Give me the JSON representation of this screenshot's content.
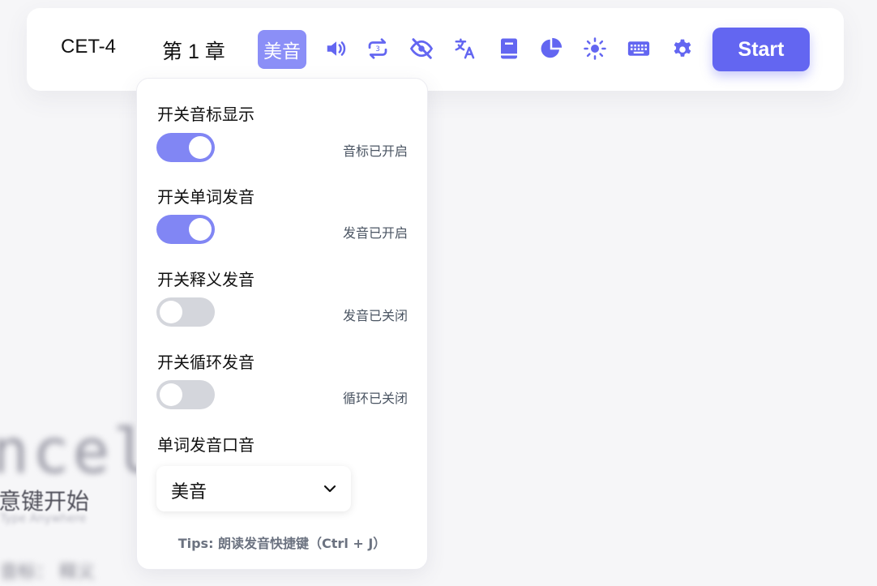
{
  "background": {
    "word_fragment": "ncel",
    "hint": "意键开始",
    "sub": "Type Anywhere",
    "bottom": "音标：  释义"
  },
  "toolbar": {
    "dictionary": "CET-4",
    "chapter": "第 1 章",
    "accent_label": "美音",
    "start_label": "Start",
    "icons": [
      "speaker-icon",
      "repeat-icon",
      "eye-off-icon",
      "translate-icon",
      "book-icon",
      "pie-chart-icon",
      "sun-icon",
      "keyboard-icon",
      "gear-icon"
    ],
    "accent_color": "#6366f1"
  },
  "panel": {
    "phonetic": {
      "title": "开关音标显示",
      "state": true,
      "status": "音标已开启"
    },
    "word_sound": {
      "title": "开关单词发音",
      "state": true,
      "status": "发音已开启"
    },
    "definition_sound": {
      "title": "开关释义发音",
      "state": false,
      "status": "发音已关闭"
    },
    "loop_sound": {
      "title": "开关循环发音",
      "state": false,
      "status": "循环已关闭"
    },
    "accent": {
      "title": "单词发音口音",
      "selected": "美音"
    },
    "tips": "Tips: 朗读发音快捷键（Ctrl + J）"
  }
}
